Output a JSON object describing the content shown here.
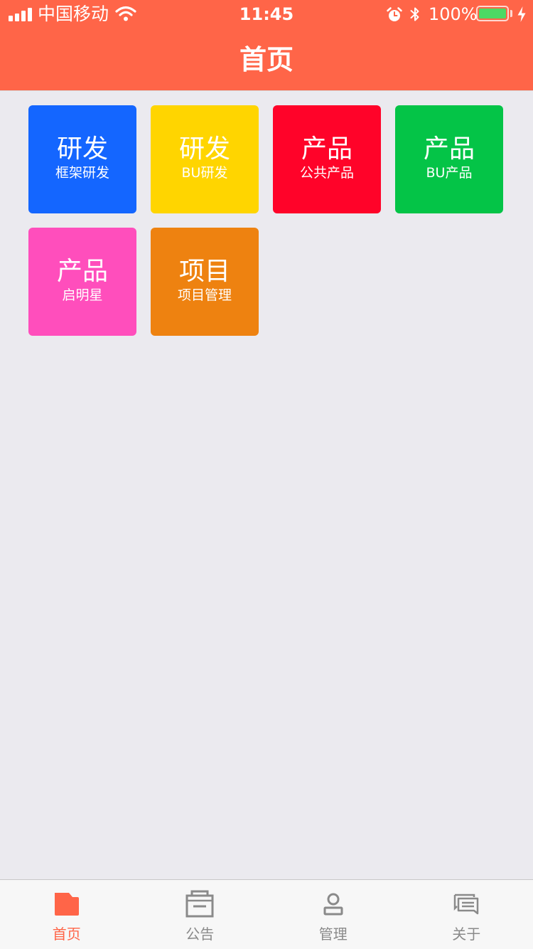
{
  "status_bar": {
    "carrier": "中国移动",
    "time": "11:45",
    "battery_percent": "100%",
    "battery_level": 1.0,
    "icons": [
      "signal-icon",
      "wifi-icon",
      "alarm-icon",
      "bluetooth-icon",
      "battery-icon",
      "charging-icon"
    ]
  },
  "nav": {
    "title": "首页"
  },
  "tiles": [
    {
      "title": "研发",
      "subtitle": "框架研发",
      "color": "#1466FF"
    },
    {
      "title": "研发",
      "subtitle": "BU研发",
      "color": "#FFD500"
    },
    {
      "title": "产品",
      "subtitle": "公共产品",
      "color": "#FF0329"
    },
    {
      "title": "产品",
      "subtitle": "BU产品",
      "color": "#04C447"
    },
    {
      "title": "产品",
      "subtitle": "启明星",
      "color": "#FF4EBC"
    },
    {
      "title": "项目",
      "subtitle": "项目管理",
      "color": "#EE8210"
    }
  ],
  "tab_bar": {
    "active_color": "#FF6548",
    "inactive_color": "#8A8A8A",
    "tabs": [
      {
        "label": "首页",
        "icon": "home-icon",
        "active": true
      },
      {
        "label": "公告",
        "icon": "announcement-icon",
        "active": false
      },
      {
        "label": "管理",
        "icon": "user-icon",
        "active": false
      },
      {
        "label": "关于",
        "icon": "chat-icon",
        "active": false
      }
    ]
  },
  "colors": {
    "brand": "#FF6548",
    "background": "#EBEAEF"
  }
}
